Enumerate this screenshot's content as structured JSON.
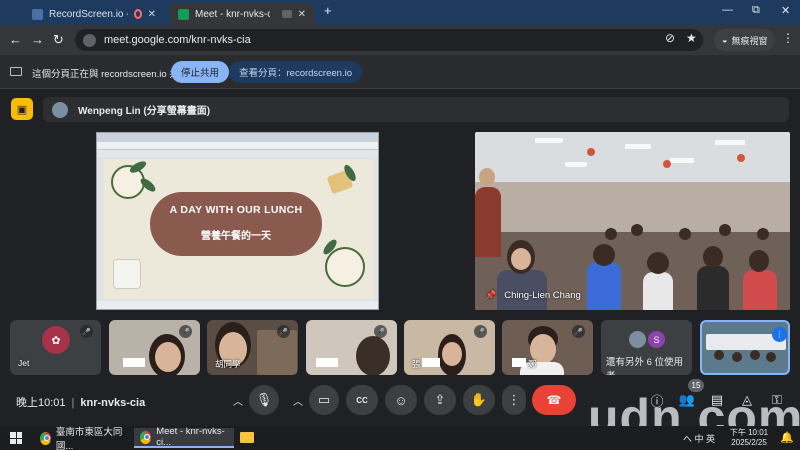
{
  "browser": {
    "tabs": [
      {
        "title": "RecordScreen.io - Record",
        "favicon_color": "#4a6fa5",
        "recording": true
      },
      {
        "title": "Meet - knr-nvks-cia",
        "favicon_color": "#0f9d58",
        "active": true
      }
    ],
    "new_tab": "+",
    "window_controls": {
      "minimize": "—",
      "maximize": "⧉",
      "close": "✕"
    },
    "address": "meet.google.com/knr-nvks-cia",
    "incognito_label": "無痕視窗",
    "nav": {
      "back": "←",
      "forward": "→",
      "reload": "↻"
    }
  },
  "share_bar": {
    "message": "這個分頁正在與 recordscreen.io 共用",
    "stop_button": "停止共用",
    "view_button": "查看分頁：recordscreen.io"
  },
  "meet": {
    "presenter": "Wenpeng Lin (分享螢幕畫面)",
    "shared_slide": {
      "title_en": "A DAY WITH OUR LUNCH",
      "title_zh": "營養午餐的一天"
    },
    "main_tile_name": "Ching-Lien Chang",
    "participants": [
      {
        "name": "Jet",
        "muted": true,
        "avatar": true
      },
      {
        "name": "",
        "muted": true
      },
      {
        "name": "胡同學",
        "muted": true
      },
      {
        "name": "",
        "muted": true
      },
      {
        "name": "張",
        "muted": true
      },
      {
        "name": "鄭",
        "muted": true
      }
    ],
    "others_label": "還有另外 6 位使用者",
    "others_avatar_letter": "S",
    "time": "晚上10:01",
    "meeting_code": "knr-nvks-cia",
    "participant_count": "15",
    "controls": [
      "mic",
      "camera",
      "captions",
      "emoji",
      "present",
      "raise-hand",
      "more",
      "end-call"
    ],
    "colors": {
      "end_call": "#ea4335",
      "presenter_badge": "#fbbc04",
      "accent": "#8ab4f8"
    }
  },
  "watermark": "udn.com",
  "taskbar": {
    "items": [
      {
        "label": "臺南市東區大同國...",
        "active": false
      },
      {
        "label": "Meet - knr-nvks-ci...",
        "active": true
      }
    ],
    "ime": "へ 中 英",
    "clock_time": "下午 10:01",
    "clock_date": "2025/2/25"
  }
}
